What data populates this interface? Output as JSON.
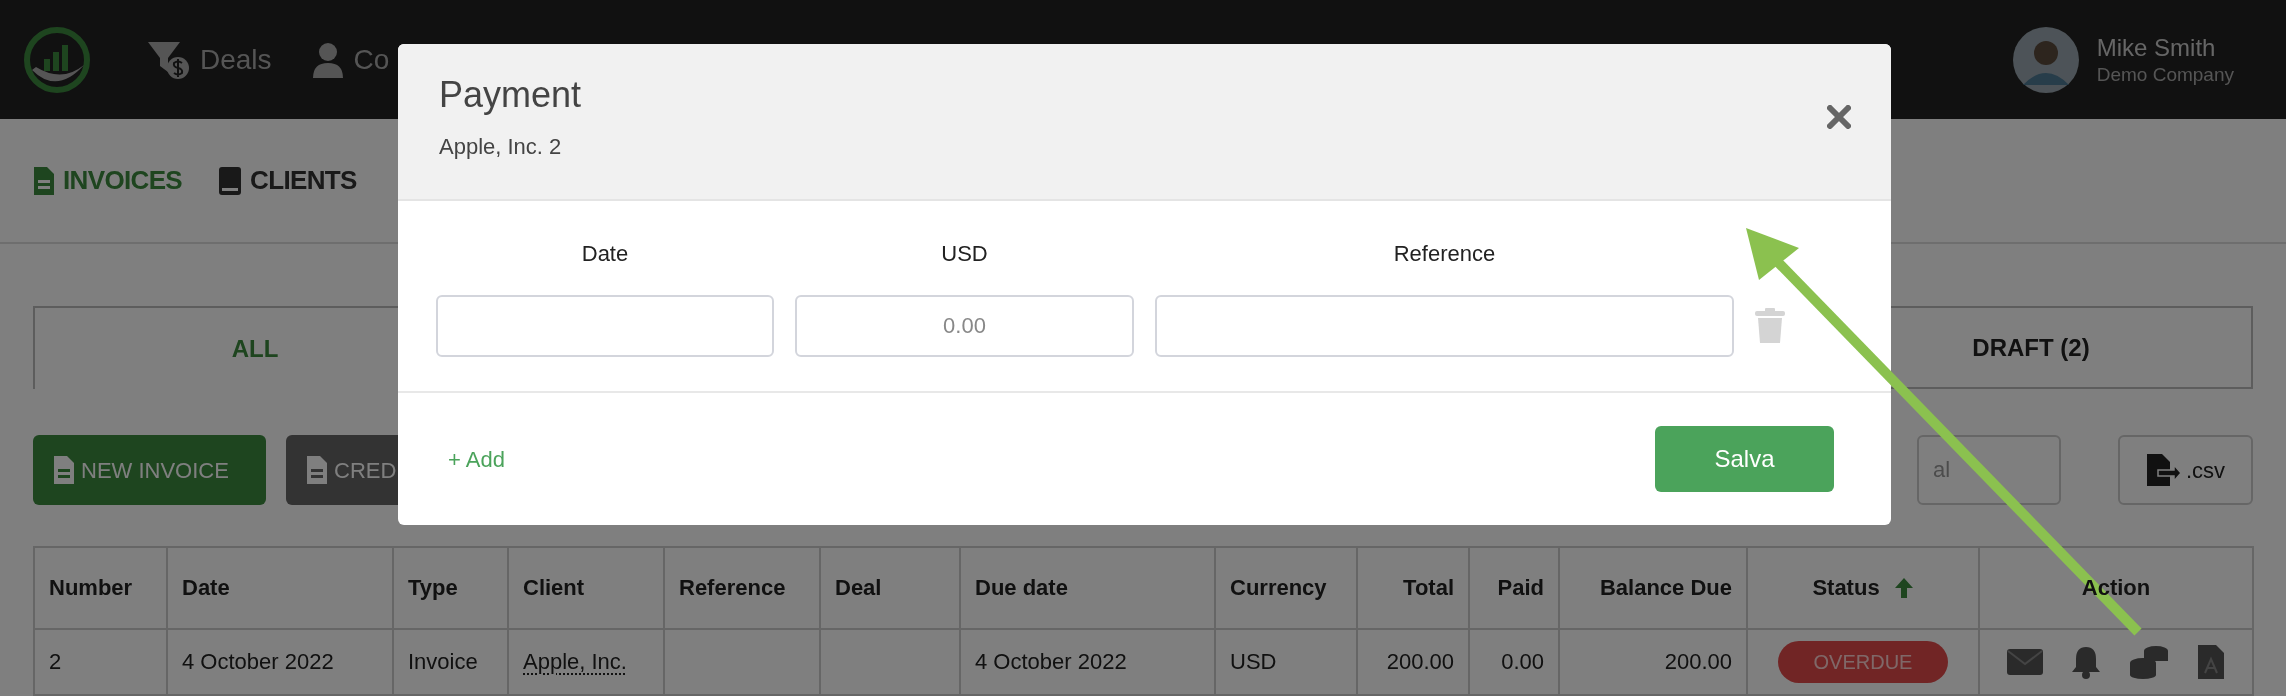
{
  "top_bar": {
    "nav_items": [
      {
        "label": "Deals",
        "kind": "funnel"
      },
      {
        "label": "Co",
        "kind": "person"
      }
    ],
    "user": {
      "name": "Mike Smith",
      "company": "Demo Company"
    }
  },
  "sub_nav": [
    {
      "label": "INVOICES",
      "selected": true
    },
    {
      "label": "CLIENTS",
      "selected": false
    }
  ],
  "filter_tabs": [
    {
      "label": "ALL",
      "selected": true
    },
    {
      "label": "DRAFT (2)",
      "selected": false
    }
  ],
  "toolbar": {
    "buttons": [
      {
        "label": "NEW INVOICE",
        "kind": "primary"
      },
      {
        "label": "CRED",
        "kind": "secondary"
      }
    ],
    "search": {
      "placeholder": "al"
    },
    "export_button": ".csv"
  },
  "table": {
    "columns": [
      "Number",
      "Date",
      "Type",
      "Client",
      "Reference",
      "Deal",
      "Due date",
      "Currency",
      "Total",
      "Paid",
      "Balance Due",
      "Status",
      "Action"
    ],
    "rows": [
      {
        "number": "2",
        "date": "4 October 2022",
        "type": "Invoice",
        "client": "Apple, Inc.",
        "due_date": "4 October 2022",
        "currency": "USD",
        "total": "200.00",
        "paid": "0.00",
        "balance_due": "200.00",
        "status": "OVERDUE"
      }
    ]
  },
  "modal": {
    "title": "Payment",
    "subtitle": "Apple, Inc. 2",
    "columns": [
      "Date",
      "USD",
      "Reference"
    ],
    "rows": [
      {
        "amount_placeholder": "0.00"
      }
    ],
    "add_link": "+ Add",
    "save_button": "Salva"
  }
}
